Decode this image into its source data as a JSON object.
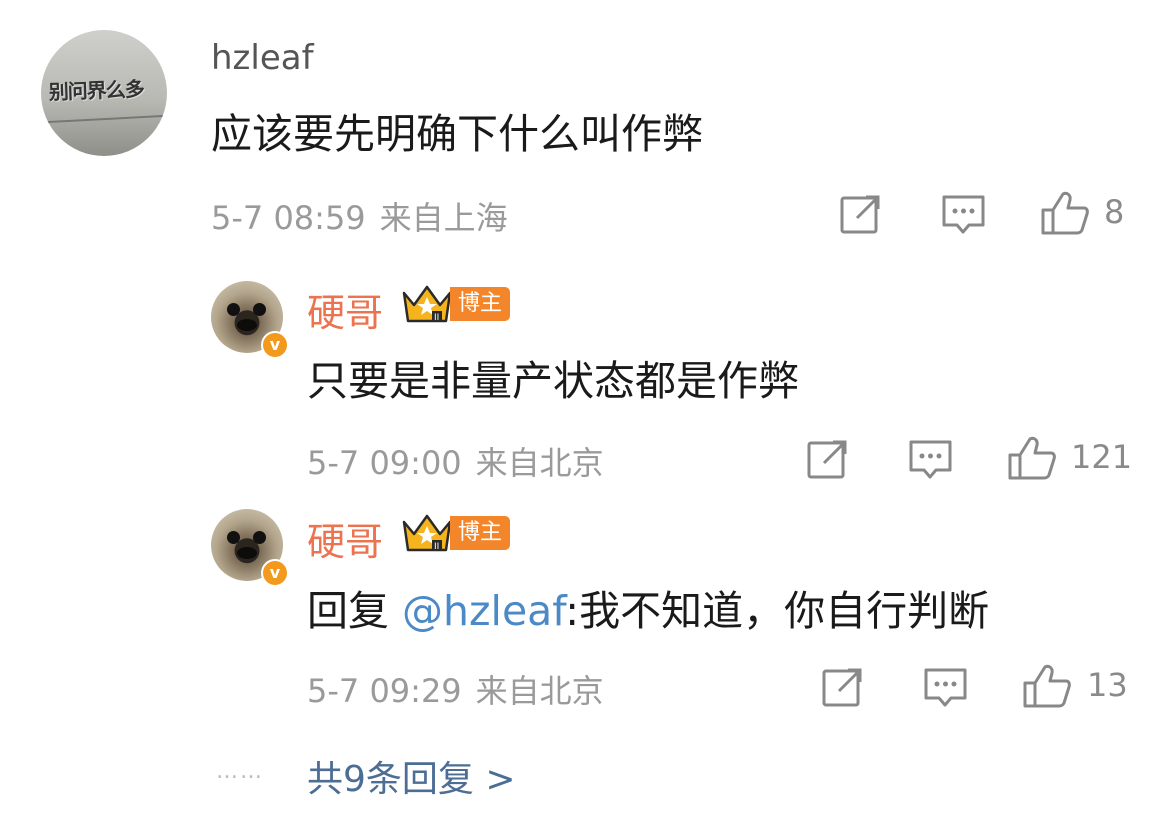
{
  "comment": {
    "username": "hzleaf",
    "avatar_text": "别问界么多",
    "text": "应该要先明确下什么叫作弊",
    "date": "5-7 08:59",
    "location": "来自上海",
    "like_count": "8"
  },
  "replies": [
    {
      "username": "硬哥",
      "badge_label": "博主",
      "text": "只要是非量产状态都是作弊",
      "date": "5-7 09:00",
      "location": "来自北京",
      "like_count": "121"
    },
    {
      "username": "硬哥",
      "badge_label": "博主",
      "reply_prefix": "回复 ",
      "mention": "@hzleaf",
      "text": ":我不知道，你自行判断",
      "date": "5-7 09:29",
      "location": "来自北京",
      "like_count": "13"
    }
  ],
  "footer": {
    "dots": "……",
    "more_replies": "共9条回复 >"
  },
  "icons": {
    "repost": "repost-icon",
    "comment": "comment-icon",
    "like": "thumbs-up-icon",
    "verified": "verified-v-icon",
    "crown": "crown-icon"
  },
  "colors": {
    "username_orange": "#eb7350",
    "mention_blue": "#4c8ac7",
    "badge_orange": "#f3862a",
    "meta_gray": "#9a9a9a"
  }
}
